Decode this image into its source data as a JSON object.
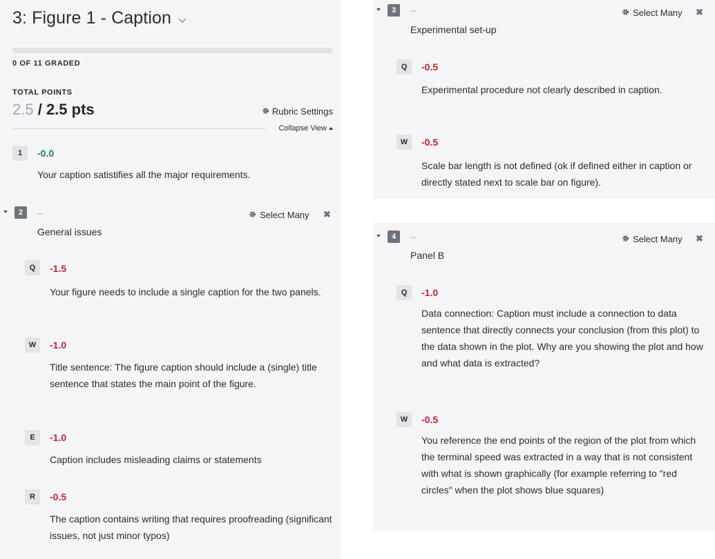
{
  "question": {
    "title": "3: Figure 1 - Caption",
    "graded_status": "0 OF 11 GRADED",
    "total_points_label": "TOTAL POINTS",
    "points_earned": "2.5",
    "points_total": "/ 2.5 pts",
    "rubric_settings_label": "Rubric Settings",
    "collapse_view_label": "Collapse View",
    "progress_fraction": 0
  },
  "items": {
    "i1": {
      "key": "1",
      "points": "-0.0",
      "description": "Your caption satistifies all the major requirements."
    }
  },
  "groups": {
    "g2": {
      "number": "2",
      "dash": "--",
      "title": "General issues",
      "select_many_label": "Select Many",
      "items": [
        {
          "key": "Q",
          "points": "-1.5",
          "description": "Your figure needs to include a single caption for the two panels."
        },
        {
          "key": "W",
          "points": "-1.0",
          "description": "Title sentence: The figure caption should include a (single) title sentence that states the main point of the figure."
        },
        {
          "key": "E",
          "points": "-1.0",
          "description": "Caption includes misleading claims or statements"
        },
        {
          "key": "R",
          "points": "-0.5",
          "description": "The caption contains writing that requires proofreading (significant issues, not just minor typos)"
        }
      ]
    },
    "g3": {
      "number": "3",
      "dash": "--",
      "title": "Experimental set-up",
      "select_many_label": "Select Many",
      "items": [
        {
          "key": "Q",
          "points": "-0.5",
          "description": "Experimental procedure not clearly described in caption."
        },
        {
          "key": "W",
          "points": "-0.5",
          "description": "Scale bar length is not defined (ok if defined either in caption or directly stated next to scale bar on figure)."
        }
      ]
    },
    "g4": {
      "number": "4",
      "dash": "--",
      "title": "Panel B",
      "select_many_label": "Select Many",
      "items": [
        {
          "key": "Q",
          "points": "-1.0",
          "description": "Data connection: Caption must include a connection to data sentence that directly connects your conclusion (from this plot) to the data shown in the plot. Why are you showing the plot and how and what data is extracted?"
        },
        {
          "key": "W",
          "points": "-0.5",
          "description": "You reference the end points of the region of the plot from which the terminal speed was extracted in a way that is not consistent with what is shown graphically (for example referring to \"red circles\" when the plot shows blue squares)"
        }
      ]
    }
  },
  "colors": {
    "negative": "#c8202f",
    "zero": "#1f7a6e",
    "panel_bg": "#f5f5f7",
    "earned": "#9ea7b3"
  },
  "icons": {
    "gear": "gear-icon",
    "close": "close-icon",
    "caret": "caret-down-icon",
    "chevron": "chevron-down-icon"
  }
}
